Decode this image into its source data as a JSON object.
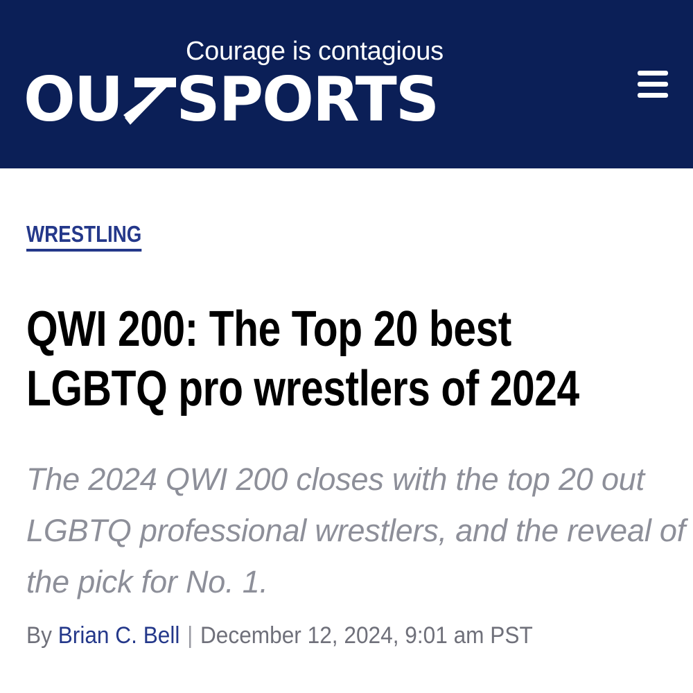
{
  "header": {
    "tagline": "Courage is contagious",
    "logo": {
      "part_left": "OU",
      "part_right": "SPORTS",
      "arrow_icon": "arrow-up-right-icon"
    },
    "menu_icon": "hamburger-menu-icon"
  },
  "article": {
    "category": "WRESTLING",
    "headline": "QWI 200: The Top 20 best LGBTQ pro wrestlers of 2024",
    "dek": "The 2024 QWI 200 closes with the top 20 out LGBTQ professional wrestlers, and the reveal of the pick for No. 1.",
    "byline": {
      "prefix": "By",
      "author": "Brian C. Bell",
      "separator": "|",
      "date": "December 12, 2024, 9:01 am PST"
    }
  },
  "colors": {
    "header_bg": "#0b1f57",
    "accent": "#24388a",
    "dek": "#8d8f99",
    "byline": "#6f707a"
  }
}
